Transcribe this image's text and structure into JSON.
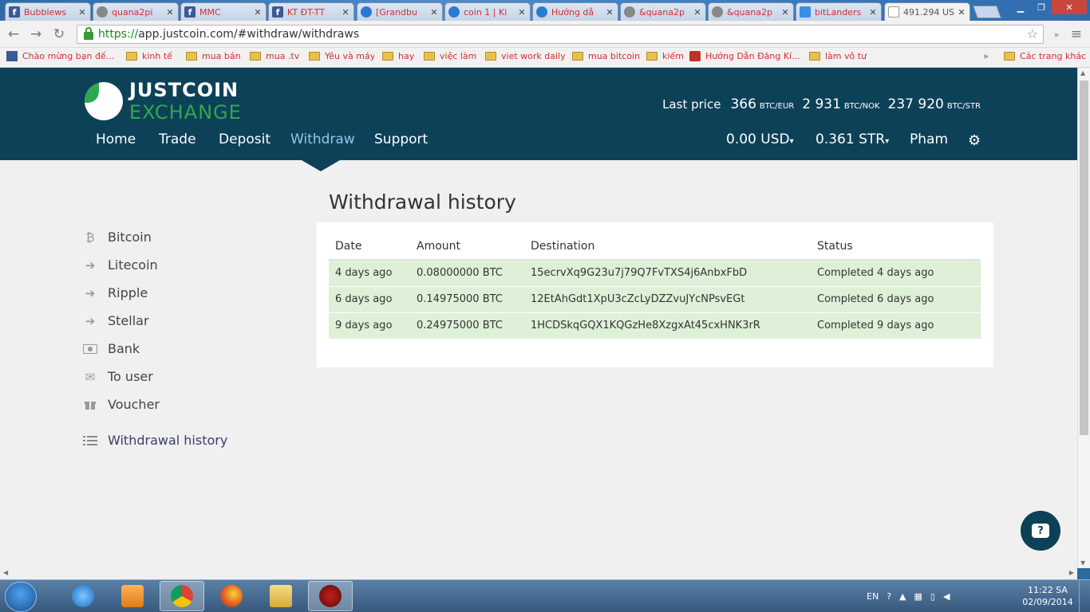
{
  "browser": {
    "tabs": [
      {
        "label": "Bubblews",
        "icon": "facebook-icon"
      },
      {
        "label": "quana2pi",
        "icon": "github-icon"
      },
      {
        "label": "MMC",
        "icon": "facebook-icon"
      },
      {
        "label": "KT ĐT-TT",
        "icon": "facebook-icon"
      },
      {
        "label": "[Grandbu",
        "icon": "globe-search-icon"
      },
      {
        "label": "coin 1 | Ki",
        "icon": "globe-search-icon"
      },
      {
        "label": "Hướng dẫ",
        "icon": "globe-search-icon"
      },
      {
        "label": "&quana2p",
        "icon": "github-icon"
      },
      {
        "label": "&quana2p",
        "icon": "github-icon"
      },
      {
        "label": "bitLanders",
        "icon": "bitlanders-icon"
      },
      {
        "label": "491.294 US",
        "icon": "document-icon",
        "active": true
      }
    ],
    "url_scheme": "https://",
    "url_rest": "app.justcoin.com/#withdraw/withdraws",
    "bookmarks": [
      {
        "label": "Chào mừng bạn đế...",
        "icon": "facebook-icon"
      },
      {
        "label": "kinh tế",
        "icon": "folder-icon"
      },
      {
        "label": "mua bán",
        "icon": "folder-icon"
      },
      {
        "label": "mua .tv",
        "icon": "folder-icon"
      },
      {
        "label": "Yêu và máy",
        "icon": "folder-icon"
      },
      {
        "label": "hay",
        "icon": "folder-icon"
      },
      {
        "label": "việc làm",
        "icon": "folder-icon"
      },
      {
        "label": "viet work daily",
        "icon": "folder-icon"
      },
      {
        "label": "mua bitcoin",
        "icon": "folder-icon"
      },
      {
        "label": "kiếm",
        "icon": "folder-icon"
      },
      {
        "label": "Hướng Dẫn Đăng Kí...",
        "icon": "dollar-icon"
      },
      {
        "label": "làm vô tư",
        "icon": "folder-icon"
      },
      {
        "label": "Các trang khác",
        "icon": "folder-icon"
      }
    ]
  },
  "brand": {
    "line1": "JUSTCOIN",
    "line2": "EXCHANGE"
  },
  "prices": {
    "label": "Last price",
    "items": [
      {
        "value": "366",
        "unit": "BTC/EUR"
      },
      {
        "value": "2 931",
        "unit": "BTC/NOK"
      },
      {
        "value": "237 920",
        "unit": "BTC/STR"
      }
    ]
  },
  "nav": {
    "home": "Home",
    "trade": "Trade",
    "deposit": "Deposit",
    "withdraw": "Withdraw",
    "support": "Support",
    "usd": "0.00 USD",
    "str": "0.361 STR",
    "user": "Pham"
  },
  "sidebar": {
    "items": [
      {
        "label": "Bitcoin",
        "icon": "bitcoin-icon"
      },
      {
        "label": "Litecoin",
        "icon": "arrow-circle-icon"
      },
      {
        "label": "Ripple",
        "icon": "arrow-circle-icon"
      },
      {
        "label": "Stellar",
        "icon": "arrow-circle-icon"
      },
      {
        "label": "Bank",
        "icon": "banknote-icon"
      },
      {
        "label": "To user",
        "icon": "envelope-icon"
      },
      {
        "label": "Voucher",
        "icon": "gift-icon"
      },
      {
        "label": "Withdrawal history",
        "icon": "list-icon",
        "active": true
      }
    ]
  },
  "main": {
    "title": "Withdrawal history",
    "columns": [
      "Date",
      "Amount",
      "Destination",
      "Status"
    ],
    "rows": [
      {
        "date": "4 days ago",
        "amount": "0.08000000 BTC",
        "destination": "15ecrvXq9G23u7j79Q7FvTXS4j6AnbxFbD",
        "status": "Completed 4 days ago"
      },
      {
        "date": "6 days ago",
        "amount": "0.14975000 BTC",
        "destination": "12EtAhGdt1XpU3cZcLyDZZvuJYcNPsvEGt",
        "status": "Completed 6 days ago"
      },
      {
        "date": "9 days ago",
        "amount": "0.24975000 BTC",
        "destination": "1HCDSkqGQX1KQGzHe8XzgxAt45cxHNK3rR",
        "status": "Completed 9 days ago"
      }
    ]
  },
  "help": {
    "label": "?"
  },
  "taskbar": {
    "language": "EN",
    "time": "11:22 SA",
    "date": "02/09/2014"
  },
  "colors": {
    "header": "#0d4158",
    "brand_green": "#2fa84e",
    "row_success": "#dff0d8",
    "active_nav": "#8ec9e8"
  }
}
